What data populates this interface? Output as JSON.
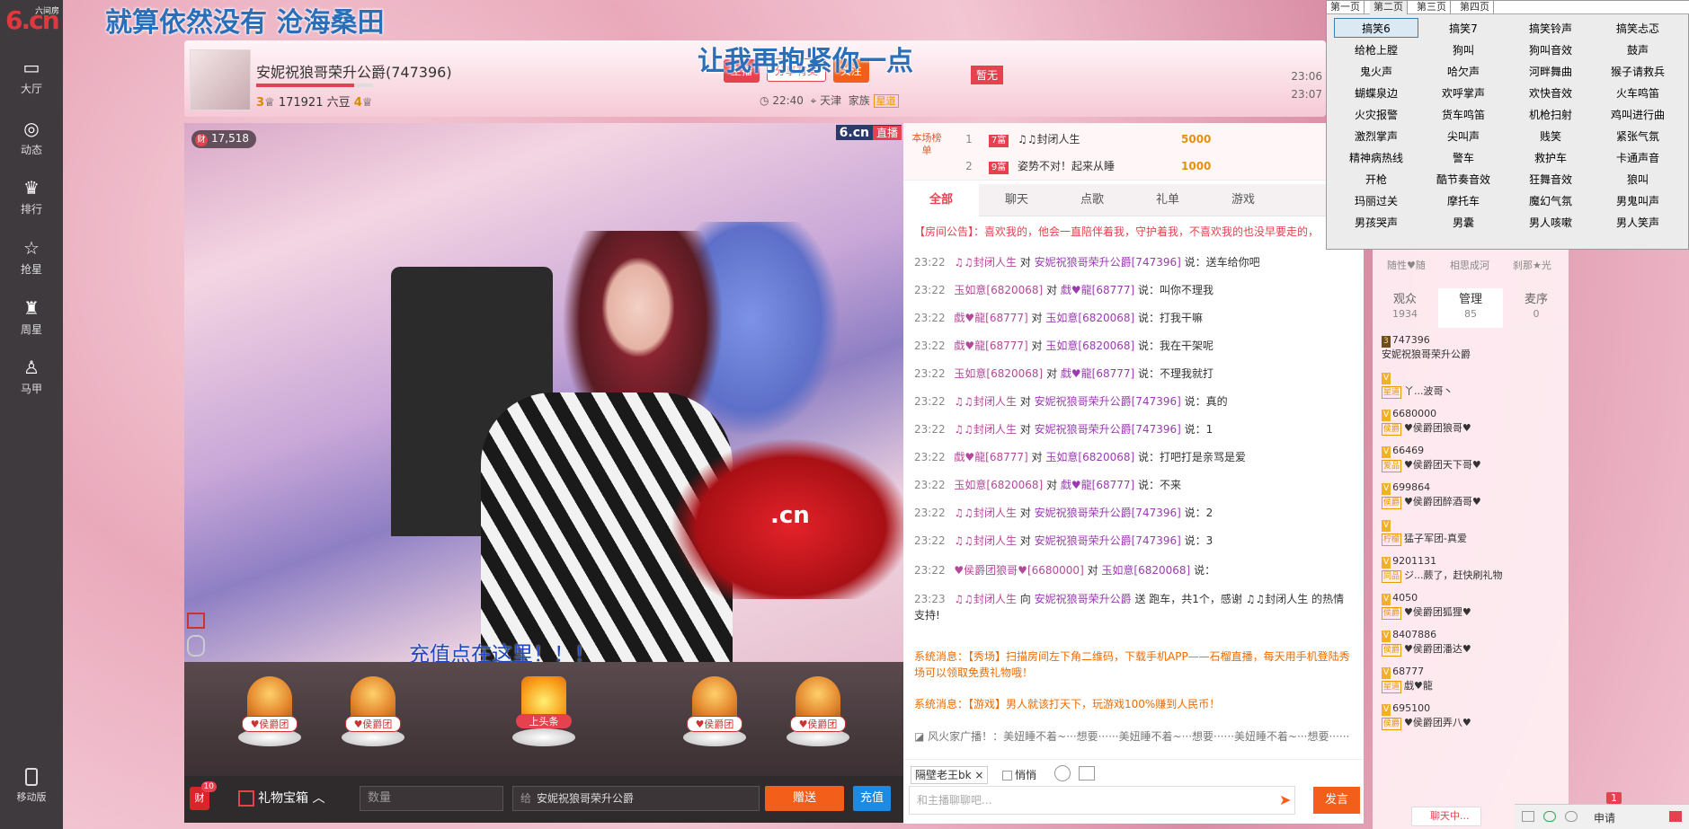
{
  "left_nav": {
    "logo_big": "6.cn",
    "logo_small": "六间房",
    "items": [
      {
        "label": "大厅",
        "icon": "tv-icon"
      },
      {
        "label": "动态",
        "icon": "compass-icon"
      },
      {
        "label": "排行",
        "icon": "crown-icon"
      },
      {
        "label": "抢星",
        "icon": "star-icon"
      },
      {
        "label": "周星",
        "icon": "trophy-icon"
      },
      {
        "label": "马甲",
        "icon": "shirt-icon"
      }
    ],
    "mobile_label": "移动版"
  },
  "lyrics": {
    "line1": "就算依然没有  沧海桑田",
    "line2": "让我再抱紧你一点"
  },
  "header": {
    "host_name": "安妮祝狼哥荣升公爵(747396)",
    "level_left": "3",
    "coins": "171921 六豆",
    "level_right": "4",
    "btn_share": "分享有奖",
    "btn_follow": "关注",
    "btn_label_small": "主播",
    "info_time": "22:40",
    "info_city": "天津",
    "info_family": "家族",
    "info_family_tag": "星道",
    "flag_text": "暂无",
    "time1": "23:06",
    "time2": "23:07"
  },
  "video": {
    "viewer_count": "17,518",
    "viewer_dot": "财",
    "brand": "6.cn",
    "brand_tag": "直播",
    "recharge_tip": "充值点在这里！！！",
    "car_text": ".cn"
  },
  "gifts": [
    {
      "label": "♥侯爵团",
      "type": "badge"
    },
    {
      "label": "♥侯爵团",
      "type": "badge"
    },
    {
      "label": "上头条",
      "type": "headline"
    },
    {
      "label": "♥侯爵团",
      "type": "badge"
    },
    {
      "label": "♥侯爵团",
      "type": "badge"
    }
  ],
  "bottom_bar": {
    "coin_label": "财",
    "coin_badge": "10",
    "gift_box": "礼物宝箱",
    "qty_placeholder": "数量",
    "to_prefix": "给",
    "to_name": "安妮祝狼哥荣升公爵",
    "send": "赠送",
    "recharge": "充值"
  },
  "rank": {
    "label": "本场榜单",
    "rows": [
      {
        "n": "1",
        "lv": "7富",
        "name": "♫♫封闭人生",
        "amt": "5000"
      },
      {
        "n": "2",
        "lv": "9富",
        "name": "姿势不对！起来从睡",
        "amt": "1000"
      }
    ]
  },
  "chat_tabs": [
    "全部",
    "聊天",
    "点歌",
    "礼单",
    "游戏"
  ],
  "notice": "【房间公告】：喜欢我的，他会一直陪伴着我，守护着我，不喜欢我的也没早要走的，",
  "messages": [
    {
      "t": "23:22",
      "u": "♫♫封闭人生",
      "mid": "对",
      "u2": "安妮祝狼哥荣升公爵[747396]",
      "text": "说：送车给你吧"
    },
    {
      "t": "23:22",
      "u": "玉如意[6820068]",
      "mid": "对",
      "u2": "戱♥龍[68777]",
      "text": "说：叫你不理我"
    },
    {
      "t": "23:22",
      "u": "戱♥龍[68777]",
      "mid": "对",
      "u2": "玉如意[6820068]",
      "text": "说：打我干嘛"
    },
    {
      "t": "23:22",
      "u": "戱♥龍[68777]",
      "mid": "对",
      "u2": "玉如意[6820068]",
      "text": "说：我在干架呢"
    },
    {
      "t": "23:22",
      "u": "玉如意[6820068]",
      "mid": "对",
      "u2": "戱♥龍[68777]",
      "text": "说：不理我就打"
    },
    {
      "t": "23:22",
      "u": "♫♫封闭人生",
      "mid": "对",
      "u2": "安妮祝狼哥荣升公爵[747396]",
      "text": "说：真的"
    },
    {
      "t": "23:22",
      "u": "♫♫封闭人生",
      "mid": "对",
      "u2": "安妮祝狼哥荣升公爵[747396]",
      "text": "说：1"
    },
    {
      "t": "23:22",
      "u": "戱♥龍[68777]",
      "mid": "对",
      "u2": "玉如意[6820068]",
      "text": "说：打吧打是亲骂是爱"
    },
    {
      "t": "23:22",
      "u": "玉如意[6820068]",
      "mid": "对",
      "u2": "戱♥龍[68777]",
      "text": "说：不来"
    },
    {
      "t": "23:22",
      "u": "♫♫封闭人生",
      "mid": "对",
      "u2": "安妮祝狼哥荣升公爵[747396]",
      "text": "说：2"
    },
    {
      "t": "23:22",
      "u": "♫♫封闭人生",
      "mid": "对",
      "u2": "安妮祝狼哥荣升公爵[747396]",
      "text": "说：3"
    },
    {
      "t": "23:22",
      "u": "♥侯爵团狼哥♥[6680000]",
      "mid": "对",
      "u2": "玉如意[6820068]",
      "text": "说："
    },
    {
      "t": "23:23",
      "u": "♫♫封闭人生",
      "mid": "向",
      "u2": "安妮祝狼哥荣升公爵",
      "text": "送 跑车，共1个，感谢 ♫♫封闭人生 的热情支持!"
    }
  ],
  "system_messages": [
    "系统消息：【秀场】扫描房间左下角二维码，下载手机APP——石榴直播，每天用手机登陆秀场可以领取免费礼物哦！",
    "系统消息：【游戏】男人就该打天下，玩游戏100%赚到人民币！"
  ],
  "broadcast": "风火家广播！：美妞睡不着~···想要······美妞睡不着~···想要······美妞睡不着~···想要······",
  "chat_tools": {
    "target": "隔壁老王bk",
    "private": "悄悄",
    "input_placeholder": "和主播聊聊吧...",
    "send": "发言"
  },
  "right_panel": {
    "top_labels": [
      "随性♥随",
      "相思成河",
      "刹那★光"
    ],
    "tabs": [
      {
        "label": "观众",
        "count": "1934"
      },
      {
        "label": "管理",
        "count": "85"
      },
      {
        "label": "麦序",
        "count": "0"
      }
    ],
    "users": [
      {
        "lv": "3",
        "id": "747396",
        "name": "安妮祝狼哥荣升公爵",
        "fam": ""
      },
      {
        "lv": "V",
        "id": "",
        "name": "丫...波哥丶",
        "fam": "星道"
      },
      {
        "lv": "V",
        "id": "6680000",
        "name": "♥侯爵团狼哥♥",
        "fam": "侯爵"
      },
      {
        "lv": "V",
        "id": "66469",
        "name": "♥侯爵团天下哥♥",
        "fam": "爱品"
      },
      {
        "lv": "V",
        "id": "699864",
        "name": "♥侯爵团醉酒哥♥",
        "fam": "侯爵"
      },
      {
        "lv": "V",
        "id": "",
        "name": "猛子军团-真爱",
        "fam": "柠檬"
      },
      {
        "lv": "V",
        "id": "9201131",
        "name": "ジ...蕨了，赶快刷礼物",
        "fam": "同品"
      },
      {
        "lv": "V",
        "id": "4050",
        "name": "♥侯爵团狐狸♥",
        "fam": "侯爵"
      },
      {
        "lv": "V",
        "id": "8407886",
        "name": "♥侯爵团潘达♥",
        "fam": "侯爵"
      },
      {
        "lv": "V",
        "id": "68777",
        "name": "戱♥龍",
        "fam": "星道"
      },
      {
        "lv": "V",
        "id": "695100",
        "name": "♥侯爵团弄八♥",
        "fam": "侯爵"
      }
    ]
  },
  "status_bar": {
    "chat_mini": "聊天中...",
    "apply": "申请",
    "apply_badge": "1"
  },
  "soundboard": {
    "tabs": [
      "第一页",
      "第二页",
      "第三页",
      "第四页"
    ],
    "cells": [
      "搞笑6",
      "搞笑7",
      "搞笑铃声",
      "搞笑忐忑",
      "给枪上膛",
      "狗叫",
      "狗叫音效",
      "鼓声",
      "鬼火声",
      "哈欠声",
      "河畔舞曲",
      "猴子请救兵",
      "蝴蝶泉边",
      "欢呼掌声",
      "欢快音效",
      "火车鸣笛",
      "火灾报警",
      "货车鸣笛",
      "机枪扫射",
      "鸡叫进行曲",
      "激烈掌声",
      "尖叫声",
      "贱笑",
      "紧张气氛",
      "精神病热线",
      "警车",
      "救护车",
      "卡通声音",
      "开枪",
      "酷节奏音效",
      "狂舞音效",
      "狼叫",
      "玛丽过关",
      "摩托车",
      "魔幻气氛",
      "男鬼叫声",
      "男孩哭声",
      "男囊",
      "男人咳嗽",
      "男人笑声"
    ]
  }
}
